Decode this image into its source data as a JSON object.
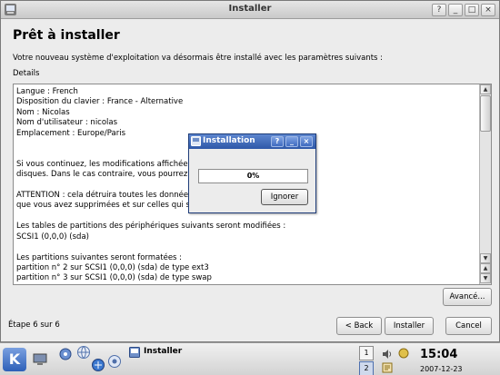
{
  "window": {
    "title": "Installer",
    "buttons": [
      "?",
      "_",
      "□",
      "×"
    ]
  },
  "page": {
    "heading": "Prêt à installer",
    "intro": "Votre nouveau système d'exploitation va désormais être installé avec les paramètres suivants :",
    "details_label": "Details",
    "details_text": "Langue : French\nDisposition du clavier : France - Alternative\nNom : Nicolas\nNom d'utilisateur : nicolas\nEmplacement : Europe/Paris\n\n\nSi vous continuez, les modifications affichées\ndisques. Dans le cas contraire, vous pourrez\n\nATTENTION : cela détruira toutes les données\nque vous avez supprimées et sur celles qui s\n\nLes tables de partitions des périphériques suivants seront modifiées :\nSCSI1 (0,0,0) (sda)\n\nLes partitions suivantes seront formatées :\npartition n° 2 sur SCSI1 (0,0,0) (sda) de type ext3\npartition n° 3 sur SCSI1 (0,0,0) (sda) de type swap",
    "advanced_button": "Avancé...",
    "step": "Étape 6 sur 6",
    "back_button": "< Back",
    "install_button": "Installer",
    "cancel_button": "Cancel"
  },
  "dialog": {
    "title": "Installation",
    "progress_percent": 0,
    "progress_label": "0%",
    "ignore_button": "Ignorer"
  },
  "taskbar": {
    "task_label": "Installer",
    "desktop_1": "1",
    "desktop_2": "2",
    "time": "15:04",
    "date": "2007-12-23"
  },
  "colors": {
    "dialog_titlebar": "#3b66b8",
    "window_bg": "#ececec"
  }
}
